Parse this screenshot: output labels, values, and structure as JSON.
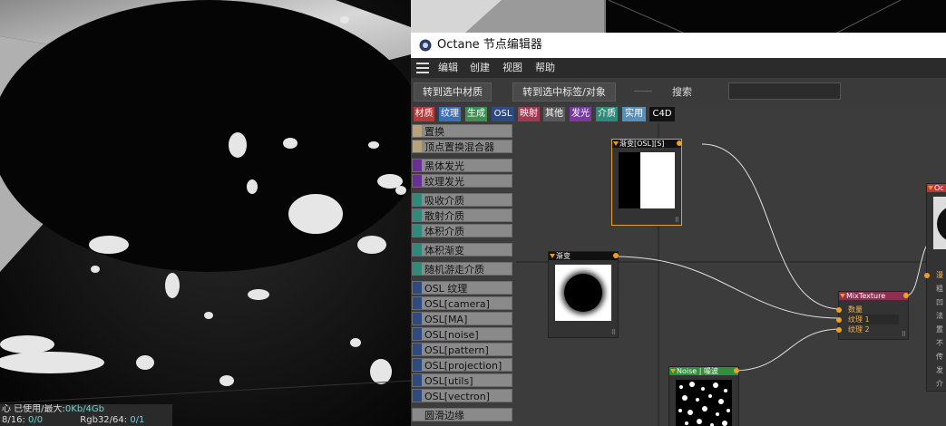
{
  "viewport": {
    "status_line1_prefix": "心 已使用/最大:",
    "status_line1_value": "0Kb/4Gb",
    "status_line2_a": "8/16:",
    "status_line2_a_val": "0/0",
    "status_line2_b": "Rgb32/64:",
    "status_line2_b_val": "0/1"
  },
  "window": {
    "title": "Octane 节点编辑器",
    "logo_icon": "octane-logo-icon"
  },
  "menu": {
    "items": [
      "编辑",
      "创建",
      "视图",
      "帮助"
    ]
  },
  "toolbar": {
    "goto_material": "转到选中材质",
    "goto_tag": "转到选中标签/对象",
    "search_label": "搜索",
    "search_value": ""
  },
  "categories": [
    {
      "label": "材质",
      "color": "#b33b3b"
    },
    {
      "label": "纹理",
      "color": "#3d6fb4"
    },
    {
      "label": "生成",
      "color": "#3f8f55"
    },
    {
      "label": "OSL",
      "color": "#2e4a7e"
    },
    {
      "label": "映射",
      "color": "#a03a55"
    },
    {
      "label": "其他",
      "color": "#5a5a5a"
    },
    {
      "label": "发光",
      "color": "#7a3aa0"
    },
    {
      "label": "介质",
      "color": "#2e8a7a"
    },
    {
      "label": "实用",
      "color": "#5a8fb8"
    },
    {
      "label": "C4D",
      "color": "#111111"
    }
  ],
  "node_list": [
    {
      "label": "置换",
      "color": "#b8a27a"
    },
    {
      "label": "顶点置换混合器",
      "color": "#b8a27a"
    },
    {
      "label": "黑体发光",
      "color": "#6a2f92"
    },
    {
      "label": "纹理发光",
      "color": "#6a2f92"
    },
    {
      "label": "吸收介质",
      "color": "#2e8a7a"
    },
    {
      "label": "散射介质",
      "color": "#2e8a7a"
    },
    {
      "label": "体积介质",
      "color": "#2e8a7a"
    },
    {
      "label": "体积渐变",
      "color": "#2e8a7a"
    },
    {
      "label": "随机游走介质",
      "color": "#2e8a7a"
    },
    {
      "label": "OSL 纹理",
      "color": "#2e4a7e"
    },
    {
      "label": "OSL[camera]",
      "color": "#2e4a7e"
    },
    {
      "label": "OSL[MA]",
      "color": "#2e4a7e"
    },
    {
      "label": "OSL[noise]",
      "color": "#2e4a7e"
    },
    {
      "label": "OSL[pattern]",
      "color": "#2e4a7e"
    },
    {
      "label": "OSL[projection]",
      "color": "#2e4a7e"
    },
    {
      "label": "OSL[utils]",
      "color": "#2e4a7e"
    },
    {
      "label": "OSL[vectron]",
      "color": "#2e4a7e"
    },
    {
      "label": "圆滑边缘",
      "color": "#8a8a8a"
    }
  ],
  "nodes": {
    "gradient_osl": {
      "title": "渐变[OSL][S]",
      "header_color": "#111111"
    },
    "gradient": {
      "title": "渐变",
      "header_color": "#111111"
    },
    "mix": {
      "title": "MixTexture",
      "header_color": "#8b3050",
      "ports": [
        "数量",
        "纹理 1",
        "纹理 2"
      ]
    },
    "noise": {
      "title": "Noise | 噪波",
      "header_color": "#2f8f3a"
    },
    "octane_mat": {
      "title": "Oc",
      "header_color": "#b33b3b",
      "ports": [
        "漫",
        "粗",
        "凹",
        "法",
        "置",
        "不",
        "传",
        "发",
        "介"
      ]
    }
  }
}
